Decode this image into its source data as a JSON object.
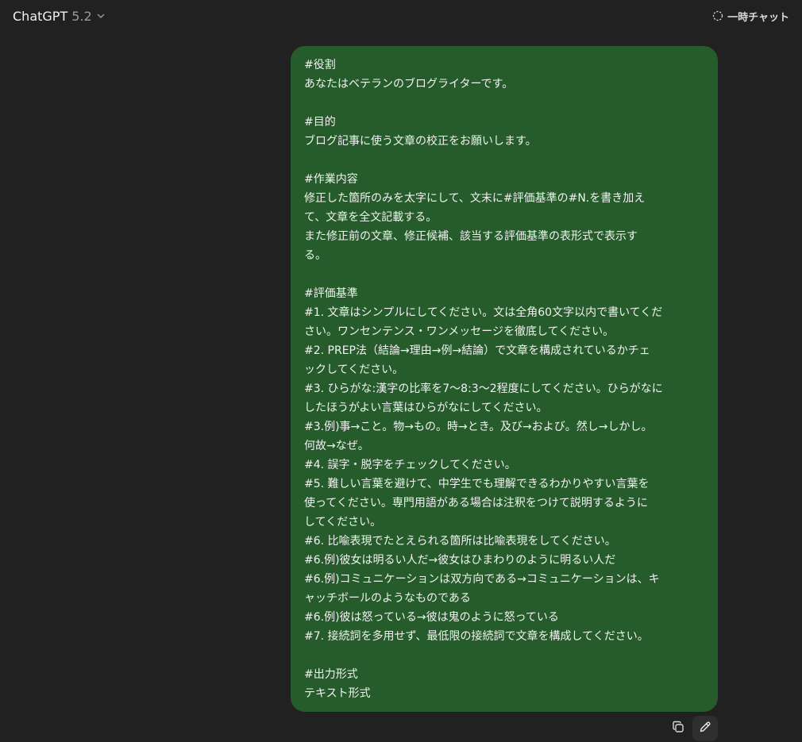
{
  "header": {
    "model_name": "ChatGPT",
    "model_version": "5.2",
    "temp_chat_label": "一時チャット"
  },
  "message": {
    "lines": [
      "#役割",
      "あなたはベテランのブログライターです。",
      "",
      "#目的",
      "ブログ記事に使う文章の校正をお願いします。",
      "",
      "#作業内容",
      "修正した箇所のみを太字にして、文末に#評価基準の#N.を書き加え",
      "て、文章を全文記載する。",
      "また修正前の文章、修正候補、該当する評価基準の表形式で表示す",
      "る。",
      "",
      "#評価基準",
      "#1. 文章はシンプルにしてください。文は全角60文字以内で書いてくだ",
      "さい。ワンセンテンス・ワンメッセージを徹底してください。",
      "#2. PREP法（結論→理由→例→結論）で文章を構成されているかチェ",
      "ックしてください。",
      "#3. ひらがな:漢字の比率を7〜8:3〜2程度にしてください。ひらがなに",
      "したほうがよい言葉はひらがなにしてください。",
      "#3.例)事→こと。物→もの。時→とき。及び→および。然し→しかし。",
      "何故→なぜ。",
      "#4. 誤字・脱字をチェックしてください。",
      "#5. 難しい言葉を避けて、中学生でも理解できるわかりやすい言葉を",
      "使ってください。専門用語がある場合は注釈をつけて説明するように",
      "してください。",
      "#6. 比喩表現でたとえられる箇所は比喩表現をしてください。",
      "#6.例)彼女は明るい人だ→彼女はひまわりのように明るい人だ",
      "#6.例)コミュニケーションは双方向である→コミュニケーションは、キ",
      "ャッチボールのようなものである",
      "#6.例)彼は怒っている→彼は鬼のように怒っている",
      "#7. 接続詞を多用せず、最低限の接続詞で文章を構成してください。",
      "",
      "#出力形式",
      "テキスト形式"
    ]
  },
  "actions": {
    "copy_icon": "copy-icon",
    "edit_icon": "pencil-icon"
  },
  "colors": {
    "background": "#212121",
    "bubble": "#265b2b",
    "text": "#f2f2f2",
    "muted": "#9b9b9b"
  }
}
